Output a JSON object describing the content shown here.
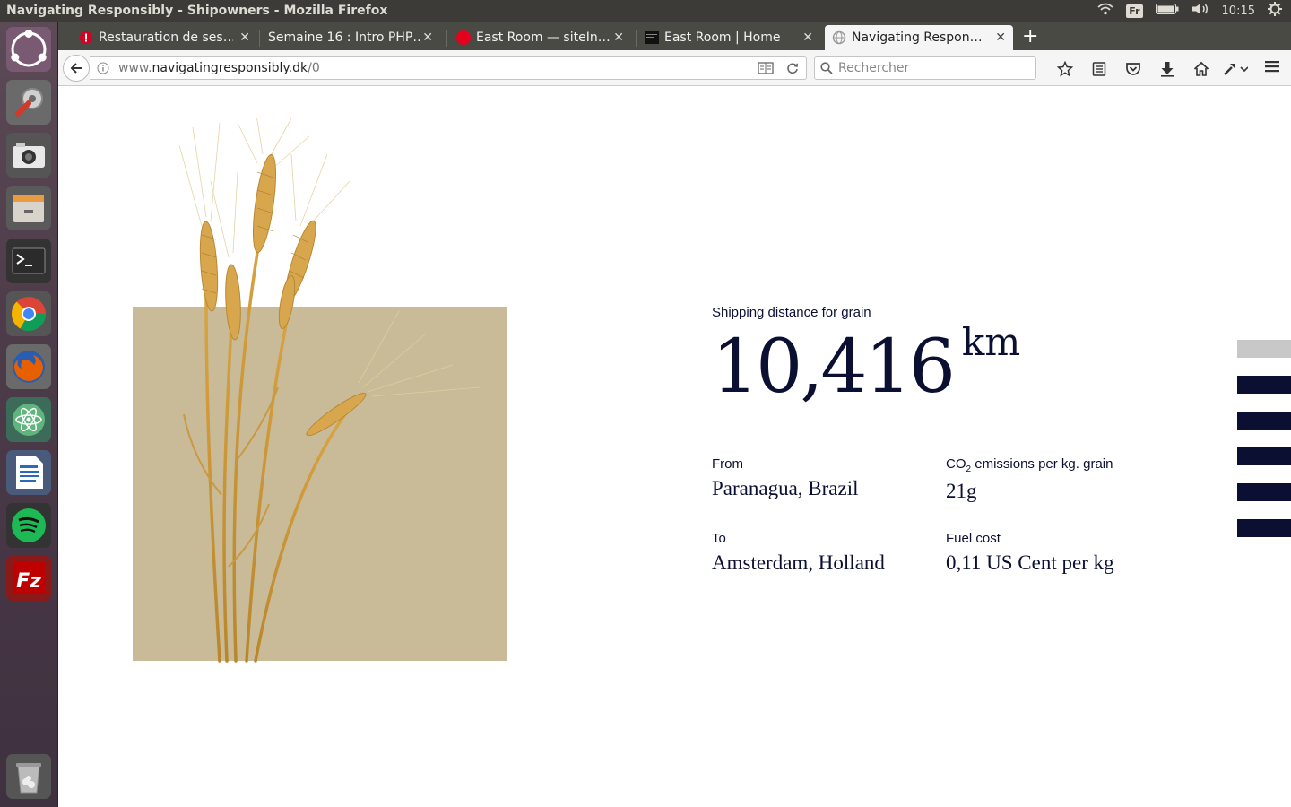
{
  "window": {
    "title": "Navigating Responsibly - Shipowners - Mozilla Firefox",
    "keyboard_layout": "Fr",
    "clock": "10:15"
  },
  "launcher": {
    "items": [
      "ubuntu-dash",
      "system-settings",
      "camera",
      "files",
      "terminal",
      "chrome",
      "firefox",
      "atom",
      "libreoffice-writer",
      "spotify",
      "filezilla",
      "trash"
    ]
  },
  "tabs": [
    {
      "label": "Restauration de ses…",
      "icon": "error-icon",
      "active": false
    },
    {
      "label": "Semaine 16 : Intro PHP…",
      "icon": "none",
      "active": false
    },
    {
      "label": "East Room — siteIn…",
      "icon": "red-dot-icon",
      "active": false
    },
    {
      "label": "East Room | Home",
      "icon": "dark-square-icon",
      "active": false
    },
    {
      "label": "Navigating Respon…",
      "icon": "globe-icon",
      "active": true
    }
  ],
  "navbar": {
    "url_prefix": "www.",
    "url_host": "navigatingresponsibly.dk",
    "url_path": "/0",
    "search_placeholder": "Rechercher"
  },
  "content": {
    "distance_label": "Shipping distance for grain",
    "distance_value": "10,416",
    "distance_unit": "km",
    "from_label": "From",
    "from_value": "Paranagua, Brazil",
    "to_label": "To",
    "to_value": "Amsterdam, Holland",
    "co2_label_prefix": "CO",
    "co2_label_sub": "2",
    "co2_label_suffix": " emissions per kg. grain",
    "co2_value": "21g",
    "fuel_label": "Fuel cost",
    "fuel_value": "0,11 US Cent per kg"
  },
  "colors": {
    "navy": "#0b1033",
    "beige_panel": "#c9bb98",
    "inactive_bar": "#c8c8c8"
  },
  "nav_indicator": {
    "count": 6,
    "active_index": 0
  }
}
